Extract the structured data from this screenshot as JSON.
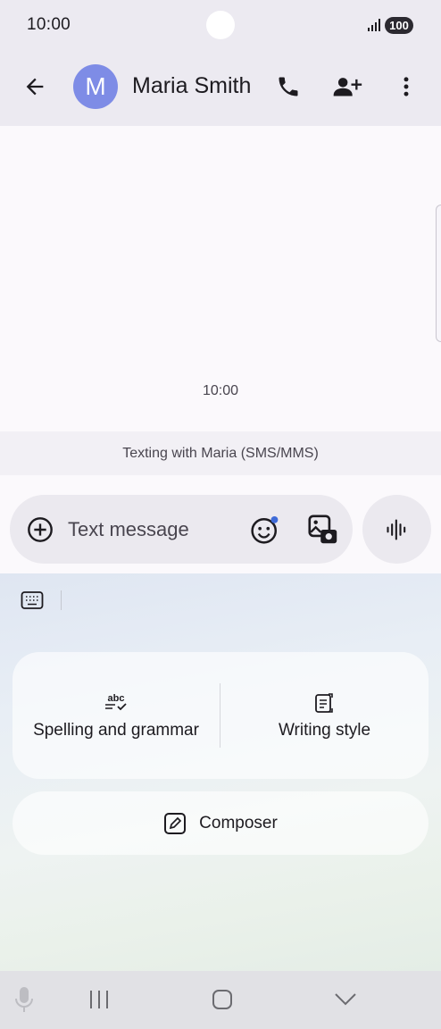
{
  "status_bar": {
    "time": "10:00",
    "battery": "100"
  },
  "header": {
    "avatar_letter": "M",
    "contact_name": "Maria Smith"
  },
  "conversation": {
    "timestamp": "10:00",
    "sms_banner": "Texting with Maria (SMS/MMS)"
  },
  "composer": {
    "placeholder": "Text message"
  },
  "keyboard_tools": {
    "spelling_label": "Spelling and grammar",
    "style_label": "Writing style",
    "composer_label": "Composer"
  },
  "colors": {
    "avatar": "#7e8ce6",
    "emoji_dot": "#3f6bd8",
    "app_bar": "#eceaf1"
  }
}
